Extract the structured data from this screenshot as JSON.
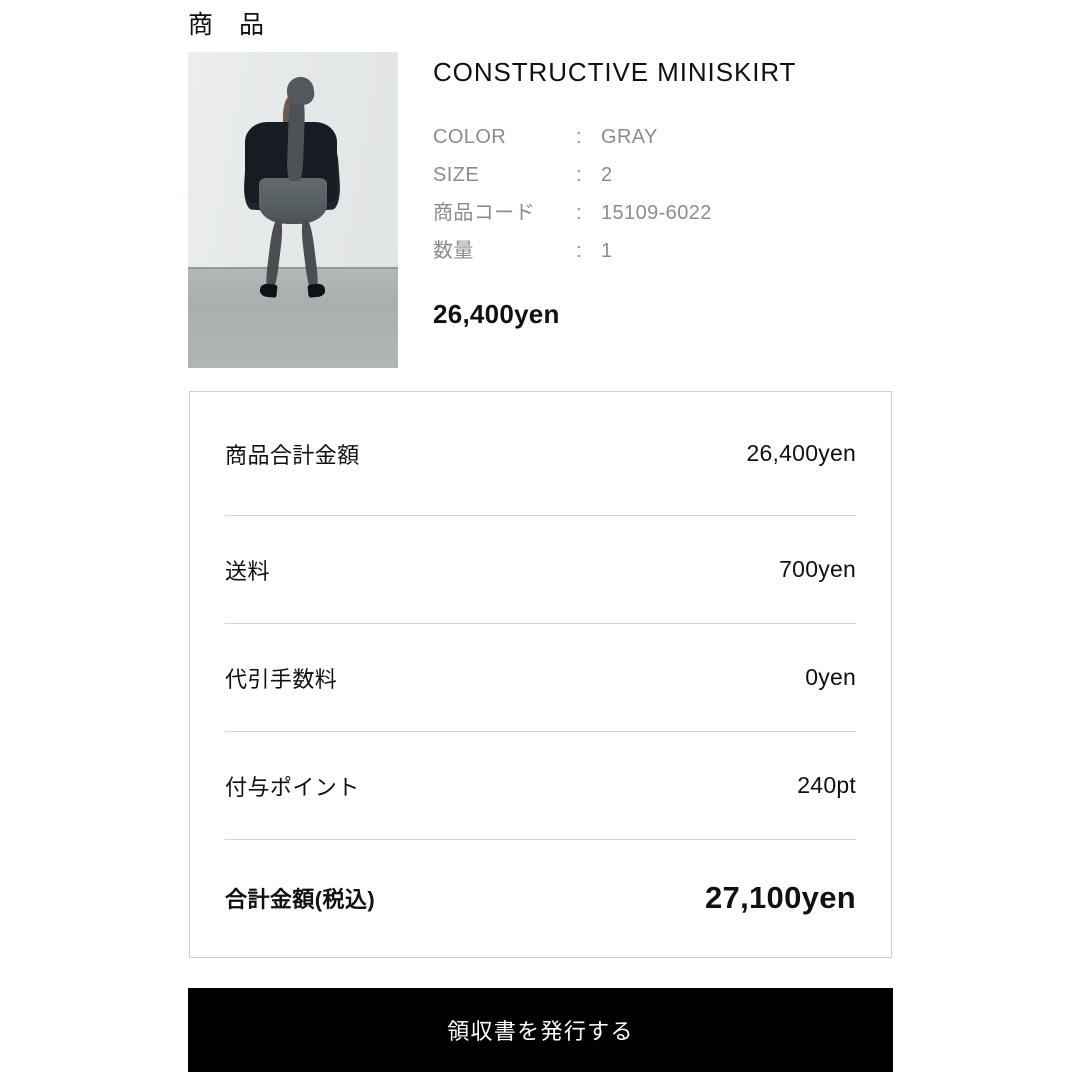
{
  "section": {
    "heading": "商　品"
  },
  "product": {
    "photo_alt": "product-photo-model-wearing-gray-miniskirt",
    "title": "CONSTRUCTIVE MINISKIRT",
    "specs": [
      {
        "label": "COLOR",
        "colon": ":",
        "value": "GRAY"
      },
      {
        "label": "SIZE",
        "colon": ":",
        "value": "2"
      },
      {
        "label": "商品コード",
        "colon": ":",
        "value": "15109-6022"
      },
      {
        "label": "数量",
        "colon": ":",
        "value": "1"
      }
    ],
    "price": "26,400yen"
  },
  "summary": {
    "rows": [
      {
        "label": "商品合計金額",
        "value": "26,400yen"
      },
      {
        "label": "送料",
        "value": "700yen"
      },
      {
        "label": "代引手数料",
        "value": "0yen"
      },
      {
        "label": "付与ポイント",
        "value": "240pt"
      },
      {
        "label": "合計金額(税込)",
        "value": "27,100yen"
      }
    ]
  },
  "actions": {
    "issue_receipt_label": "領収書を発行する"
  },
  "colors": {
    "page_background": "#ffffff",
    "text_primary": "#111111",
    "text_muted": "#8c8c8c",
    "box_border": "#cfcfcf",
    "divider": "#d6d6d6",
    "button_background": "#000000",
    "button_text": "#ffffff"
  }
}
